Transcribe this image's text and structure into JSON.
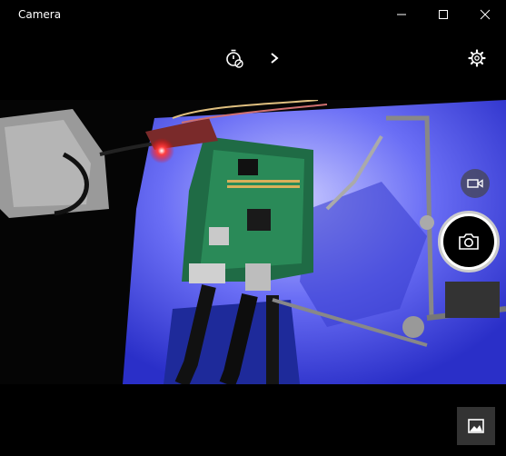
{
  "window": {
    "title": "Camera",
    "controls": [
      "minimize",
      "maximize",
      "close"
    ]
  },
  "toolbar": {
    "timer_icon": "timer-off-icon",
    "expand_icon": "chevron-right-icon",
    "settings_icon": "gear-icon"
  },
  "capture": {
    "video_mode_icon": "video-camera-icon",
    "photo_button_icon": "camera-icon",
    "gallery_icon": "image-icon"
  },
  "colors": {
    "background": "#000000",
    "shutter_ring": "#ffffff",
    "gallery_bg": "#333333"
  }
}
